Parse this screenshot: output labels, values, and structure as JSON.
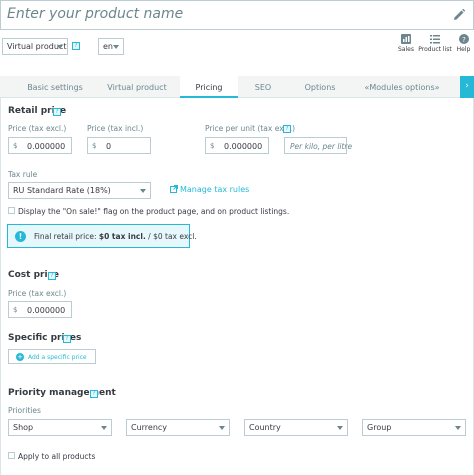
{
  "header": {
    "product_name_placeholder": "Enter your product name",
    "product_type": "Virtual product",
    "language": "en",
    "toolbar": {
      "sales_label": "Sales",
      "product_list_label": "Product list",
      "help_label": "Help"
    }
  },
  "tabs": [
    {
      "label": "Basic settings"
    },
    {
      "label": "Virtual product"
    },
    {
      "label": "Pricing"
    },
    {
      "label": "SEO"
    },
    {
      "label": "Options"
    },
    {
      "label": "«Modules options»"
    }
  ],
  "retail_price": {
    "title": "Retail price",
    "tax_excl_label": "Price (tax excl.)",
    "tax_excl_value": "0.000000",
    "tax_incl_label": "Price (tax incl.)",
    "tax_incl_value": "0",
    "unit_label": "Price per unit (tax excl.)",
    "unit_value": "0.000000",
    "unit_placeholder": "Per kilo, per litre",
    "currency": "$",
    "tax_rule_label": "Tax rule",
    "tax_rule_value": "RU Standard Rate (18%)",
    "manage_tax_link": "Manage tax rules",
    "on_sale_label": "Display the \"On sale!\" flag on the product page, and on product listings.",
    "final_price_prefix": "Final retail price: ",
    "final_price_incl": "$0 tax incl.",
    "final_price_excl": " / $0 tax excl."
  },
  "cost_price": {
    "title": "Cost price",
    "label": "Price (tax excl.)",
    "value": "0.000000",
    "currency": "$"
  },
  "specific_prices": {
    "title": "Specific prices",
    "add_button": "Add a specific price"
  },
  "priority": {
    "title": "Priority management",
    "priorities_label": "Priorities",
    "options": [
      "Shop",
      "Currency",
      "Country",
      "Group"
    ],
    "apply_all_label": "Apply to all products"
  },
  "colors": {
    "accent": "#25b9d7",
    "text": "#363a41",
    "muted": "#6c868e",
    "border": "#bbcdd2"
  }
}
